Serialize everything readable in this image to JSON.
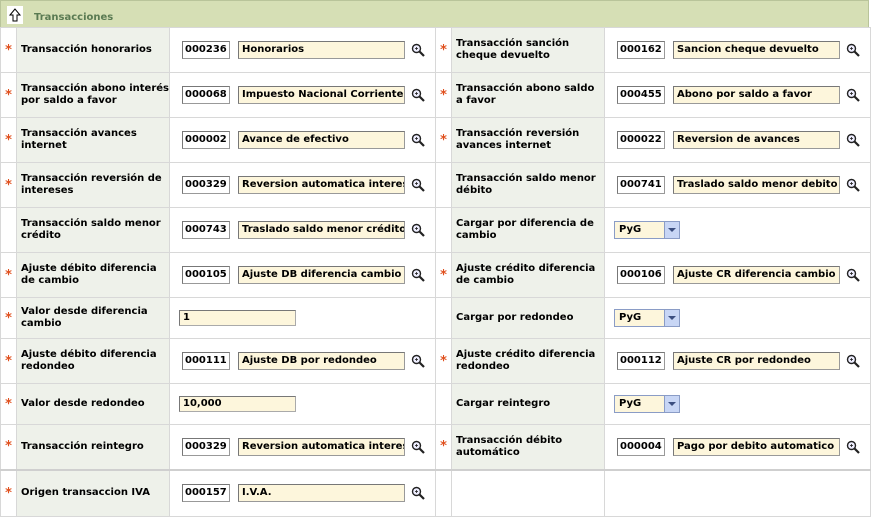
{
  "header": {
    "title": "Transacciones"
  },
  "rows": [
    {
      "left": {
        "required": true,
        "label": "Transacción honorarios",
        "code": "000236",
        "desc": "Honorarios"
      },
      "right": {
        "required": true,
        "label": "Transacción sanción cheque devuelto",
        "code": "000162",
        "desc": "Sancion cheque devuelto"
      }
    },
    {
      "left": {
        "required": true,
        "label": "Transacción abono interés por saldo a favor",
        "code": "000068",
        "desc": "Impuesto Nacional Corriente"
      },
      "right": {
        "required": true,
        "label": "Transacción abono saldo a favor",
        "code": "000455",
        "desc": "Abono por saldo a favor"
      }
    },
    {
      "left": {
        "required": true,
        "label": "Transacción avances internet",
        "code": "000002",
        "desc": "Avance de efectivo"
      },
      "right": {
        "required": true,
        "label": "Transacción reversión avances internet",
        "code": "000022",
        "desc": "Reversion de avances"
      }
    },
    {
      "left": {
        "required": true,
        "label": "Transacción reversión de intereses",
        "code": "000329",
        "desc": "Reversion automatica intereses"
      },
      "right": {
        "required": false,
        "label": "Transacción saldo menor débito",
        "code": "000741",
        "desc": "Traslado saldo menor debito"
      }
    },
    {
      "left": {
        "required": false,
        "label": "Transacción saldo menor crédito",
        "code": "000743",
        "desc": "Traslado saldo menor crédito"
      },
      "right": {
        "required": false,
        "label": "Cargar por diferencia de cambio",
        "select": "PyG"
      }
    },
    {
      "left": {
        "required": true,
        "label": "Ajuste débito diferencia de cambio",
        "code": "000105",
        "desc": "Ajuste DB diferencia cambio"
      },
      "right": {
        "required": true,
        "label": "Ajuste crédito diferencia de cambio",
        "code": "000106",
        "desc": "Ajuste CR diferencia cambio"
      }
    },
    {
      "left": {
        "required": true,
        "label": "Valor desde diferencia cambio",
        "value": "1"
      },
      "right": {
        "required": false,
        "label": "Cargar por redondeo",
        "select": "PyG"
      }
    },
    {
      "left": {
        "required": true,
        "label": "Ajuste débito diferencia redondeo",
        "code": "000111",
        "desc": "Ajuste DB por redondeo"
      },
      "right": {
        "required": true,
        "label": "Ajuste crédito diferencia redondeo",
        "code": "000112",
        "desc": "Ajuste CR por redondeo"
      }
    },
    {
      "left": {
        "required": true,
        "label": "Valor desde redondeo",
        "value": "10,000"
      },
      "right": {
        "required": false,
        "label": "Cargar reintegro",
        "select": "PyG"
      }
    },
    {
      "left": {
        "required": true,
        "label": "Transacción reintegro",
        "code": "000329",
        "desc": "Reversion automatica intereses"
      },
      "right": {
        "required": true,
        "label": "Transacción débito automático",
        "code": "000004",
        "desc": "Pago por debito automatico"
      }
    },
    {
      "left": {
        "required": true,
        "label": "Origen transaccion IVA",
        "code": "000157",
        "desc": "I.V.A."
      },
      "right": null
    }
  ],
  "required_mark": "*",
  "colors": {
    "header_bg": "#d6dfb5",
    "label_bg": "#eef1ea",
    "required": "#e0501e",
    "field_bg": "#fdf6dc"
  }
}
